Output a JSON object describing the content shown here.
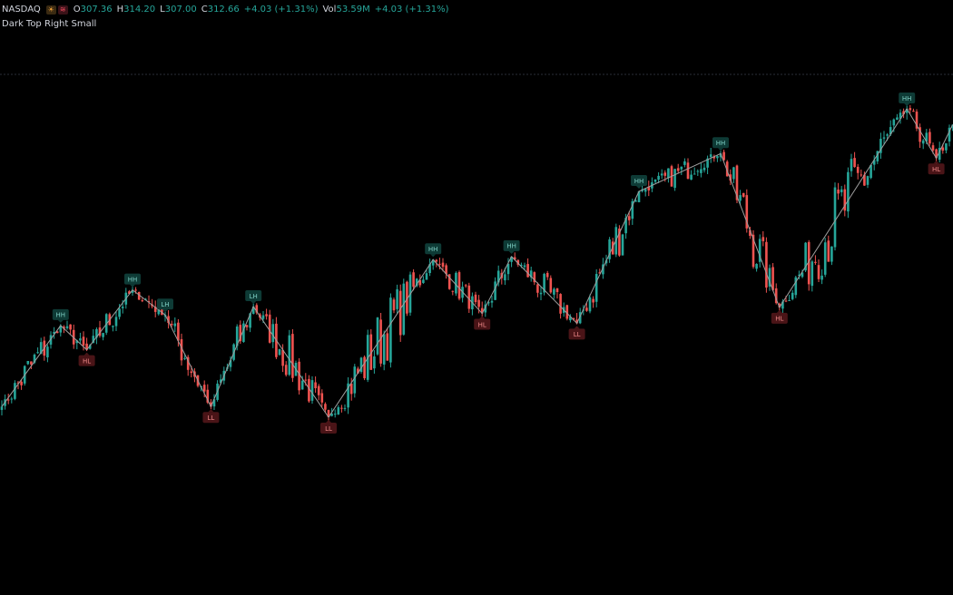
{
  "header": {
    "symbol": "NASDAQ",
    "open_label": "O",
    "open_value": "307.36",
    "high_label": "H",
    "high_value": "314.20",
    "low_label": "L",
    "low_value": "307.00",
    "close_label": "C",
    "close_value": "312.66",
    "change": "+4.03 (+1.31%)",
    "vol_label": "Vol",
    "vol_value": "53.59",
    "vol_unit": "M",
    "vol_change": "+4.03 (+1.31%)",
    "indicator_name": "Dark Top Right Small"
  },
  "colors": {
    "up": "#26a69a",
    "down": "#ef5350",
    "background": "#000000",
    "text": "#d1d4dc",
    "zigzag": "#9e9e9e",
    "label_high_bg": "#0e3b36",
    "label_high_text": "#7fd1c6",
    "label_low_bg": "#4a1417",
    "label_low_text": "#f08a8a"
  },
  "icons": [
    "market-closed-icon",
    "data-delay-icon"
  ],
  "chart_data": {
    "type": "candlestick",
    "grid": false,
    "legend": "top-left",
    "y_price_range": [
      285,
      325
    ],
    "swing_points": [
      {
        "bar": 0,
        "price": 290.8,
        "kind": "start",
        "label": ""
      },
      {
        "bar": 18,
        "price": 301.5,
        "kind": "high",
        "label": "HH"
      },
      {
        "bar": 26,
        "price": 298.3,
        "kind": "low",
        "label": "HL"
      },
      {
        "bar": 40,
        "price": 306.2,
        "kind": "high",
        "label": "HH"
      },
      {
        "bar": 50,
        "price": 302.9,
        "kind": "high",
        "label": "LH"
      },
      {
        "bar": 64,
        "price": 290.8,
        "kind": "low",
        "label": "LL"
      },
      {
        "bar": 77,
        "price": 304.0,
        "kind": "high",
        "label": "LH"
      },
      {
        "bar": 100,
        "price": 289.4,
        "kind": "low",
        "label": "LL"
      },
      {
        "bar": 132,
        "price": 310.2,
        "kind": "high",
        "label": "HH"
      },
      {
        "bar": 147,
        "price": 303.1,
        "kind": "low",
        "label": "HL"
      },
      {
        "bar": 156,
        "price": 310.6,
        "kind": "high",
        "label": "HH"
      },
      {
        "bar": 176,
        "price": 301.8,
        "kind": "low",
        "label": "LL"
      },
      {
        "bar": 195,
        "price": 319.2,
        "kind": "high",
        "label": "HH"
      },
      {
        "bar": 220,
        "price": 324.2,
        "kind": "high",
        "label": "HH"
      },
      {
        "bar": 238,
        "price": 303.9,
        "kind": "low",
        "label": "HL"
      },
      {
        "bar": 277,
        "price": 330.1,
        "kind": "high",
        "label": "HH"
      },
      {
        "bar": 286,
        "price": 323.6,
        "kind": "low",
        "label": "HL"
      },
      {
        "bar": 291,
        "price": 328.0,
        "kind": "end",
        "label": ""
      }
    ]
  }
}
